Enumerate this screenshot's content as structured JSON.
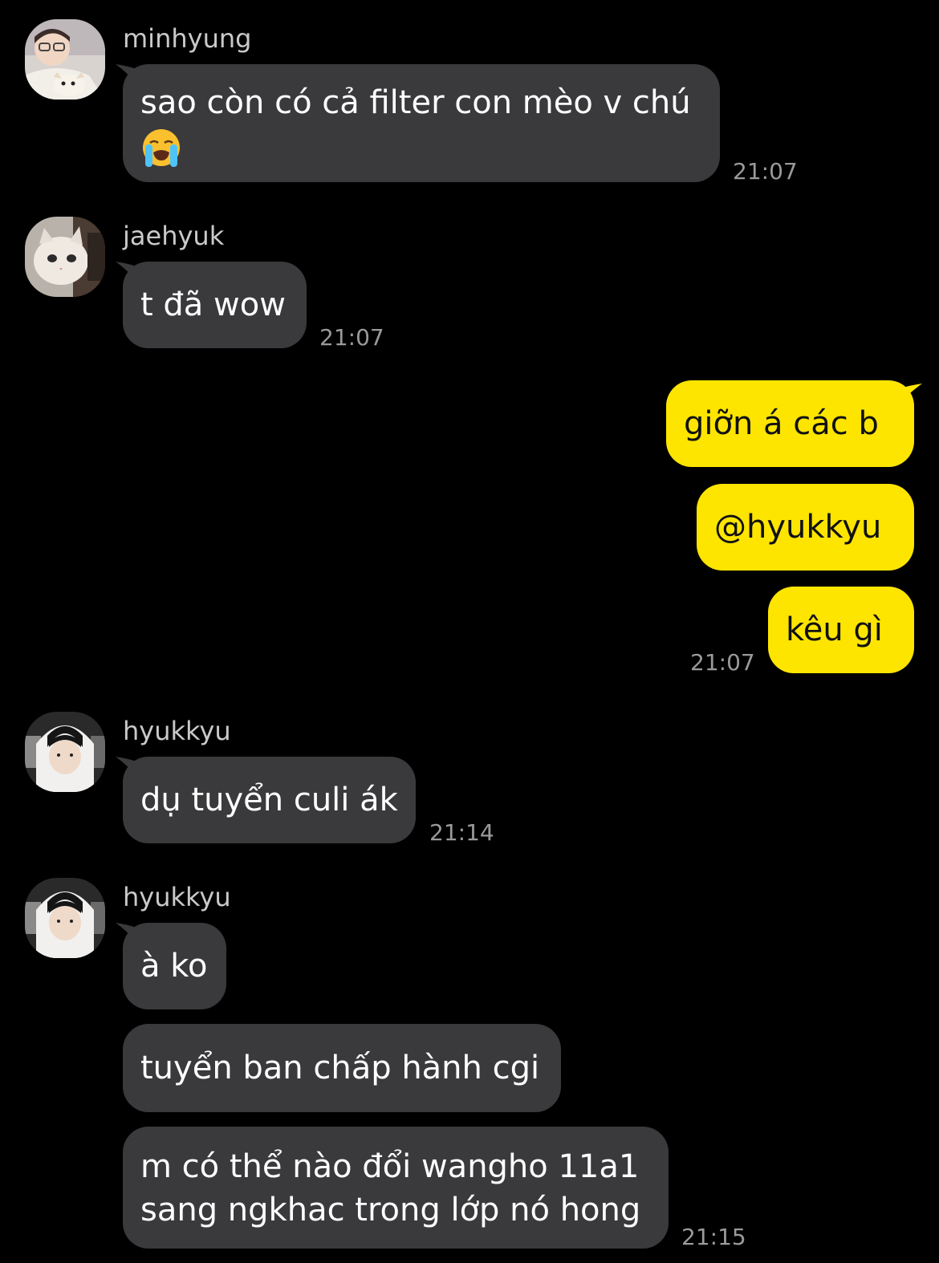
{
  "colors": {
    "background": "#000000",
    "incoming_bubble": "#3a3a3c",
    "outgoing_bubble": "#fde500",
    "sender_name": "#c9c9c9",
    "timestamp": "#9a9a9a"
  },
  "messages": [
    {
      "sender": "minhyung",
      "avatar_icon": "user-avatar-minhyung",
      "lines": [
        "sao còn có cả filter con mèo v chú"
      ],
      "emoji_icon": "loudly-crying-face-icon",
      "time": "21:07"
    },
    {
      "sender": "jaehyuk",
      "avatar_icon": "user-avatar-jaehyuk-cat",
      "lines": [
        "t đã wow"
      ],
      "time": "21:07"
    },
    {
      "sender": "me",
      "outgoing": [
        {
          "text": "giỡn á các b"
        },
        {
          "text": "@hyukkyu"
        },
        {
          "text": "kêu gì"
        }
      ],
      "time": "21:07"
    },
    {
      "sender": "hyukkyu",
      "avatar_icon": "user-avatar-hyukkyu",
      "lines": [
        "dụ tuyển culi ák"
      ],
      "time": "21:14"
    },
    {
      "sender": "hyukkyu",
      "avatar_icon": "user-avatar-hyukkyu",
      "bubbles": [
        {
          "lines": [
            "à ko"
          ]
        },
        {
          "lines": [
            "tuyển ban chấp hành cgi"
          ]
        },
        {
          "lines": [
            "m có thể nào đổi wangho 11a1",
            "sang ngkhac trong lớp nó hong"
          ]
        }
      ],
      "time": "21:15"
    }
  ]
}
